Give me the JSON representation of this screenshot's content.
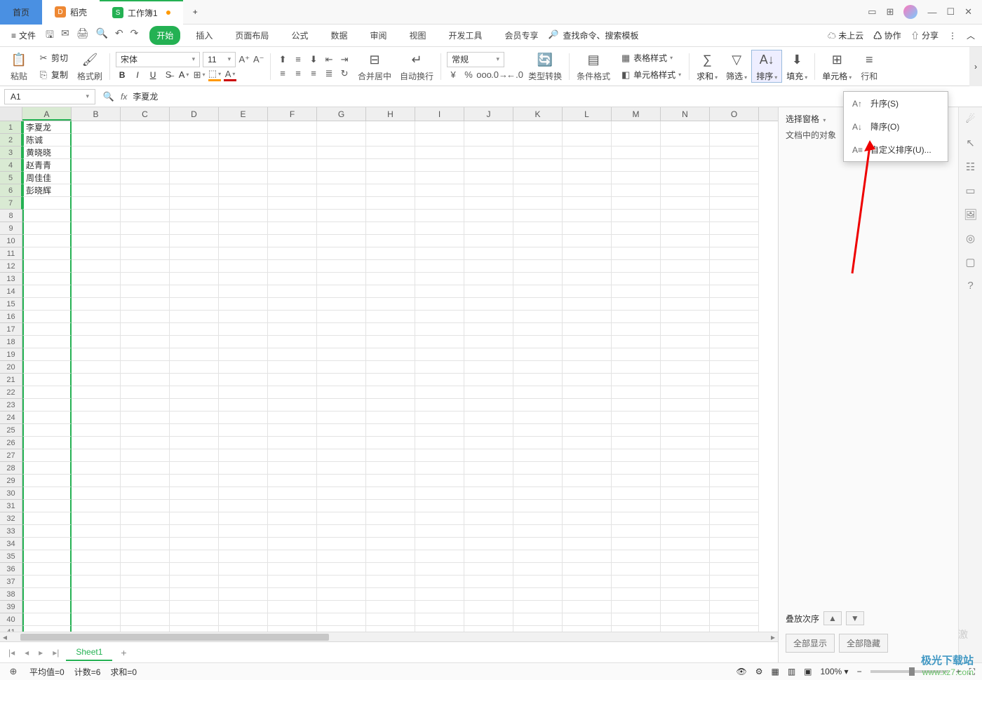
{
  "titlebar": {
    "home": "首页",
    "app2": "稻壳",
    "doc": "工作簿1",
    "add": "+"
  },
  "menu": {
    "file": "文件",
    "tabs": [
      "开始",
      "插入",
      "页面布局",
      "公式",
      "数据",
      "审阅",
      "视图",
      "开发工具",
      "会员专享"
    ],
    "search_placeholder": "查找命令、搜索模板",
    "cloud": "未上云",
    "coop": "协作",
    "share": "分享"
  },
  "ribbon": {
    "paste": "粘贴",
    "cut": "剪切",
    "copy": "复制",
    "format_painter": "格式刷",
    "font": "宋体",
    "size": "11",
    "merge": "合并居中",
    "wrap": "自动换行",
    "numfmt": "常规",
    "type_convert": "类型转换",
    "cond_fmt": "条件格式",
    "table_style": "表格样式",
    "cell_style": "单元格样式",
    "sum": "求和",
    "filter": "筛选",
    "sort": "排序",
    "fill": "填充",
    "cells": "单元格",
    "rows": "行和"
  },
  "namebox": "A1",
  "formula_value": "李夏龙",
  "columns": [
    "A",
    "B",
    "C",
    "D",
    "E",
    "F",
    "G",
    "H",
    "I",
    "J",
    "K",
    "L",
    "M",
    "N",
    "O"
  ],
  "data_rows": [
    "李夏龙",
    "陈诚",
    "黄晓晓",
    "赵青青",
    "周佳佳",
    "彭晓辉"
  ],
  "row_count": 41,
  "panel": {
    "select": "选择窗格",
    "title": "文档中的对象",
    "stack": "叠放次序",
    "show_all": "全部显示",
    "hide_all": "全部隐藏"
  },
  "sort_menu": {
    "asc": "升序(S)",
    "desc": "降序(O)",
    "custom": "自定义排序(U)..."
  },
  "sheet": {
    "name": "Sheet1"
  },
  "status": {
    "avg": "平均值=0",
    "count": "计数=6",
    "sum": "求和=0",
    "zoom": "100%"
  },
  "watermark": {
    "t1": "极光下载站",
    "t2": "www.xz7.com"
  },
  "activate": "激"
}
